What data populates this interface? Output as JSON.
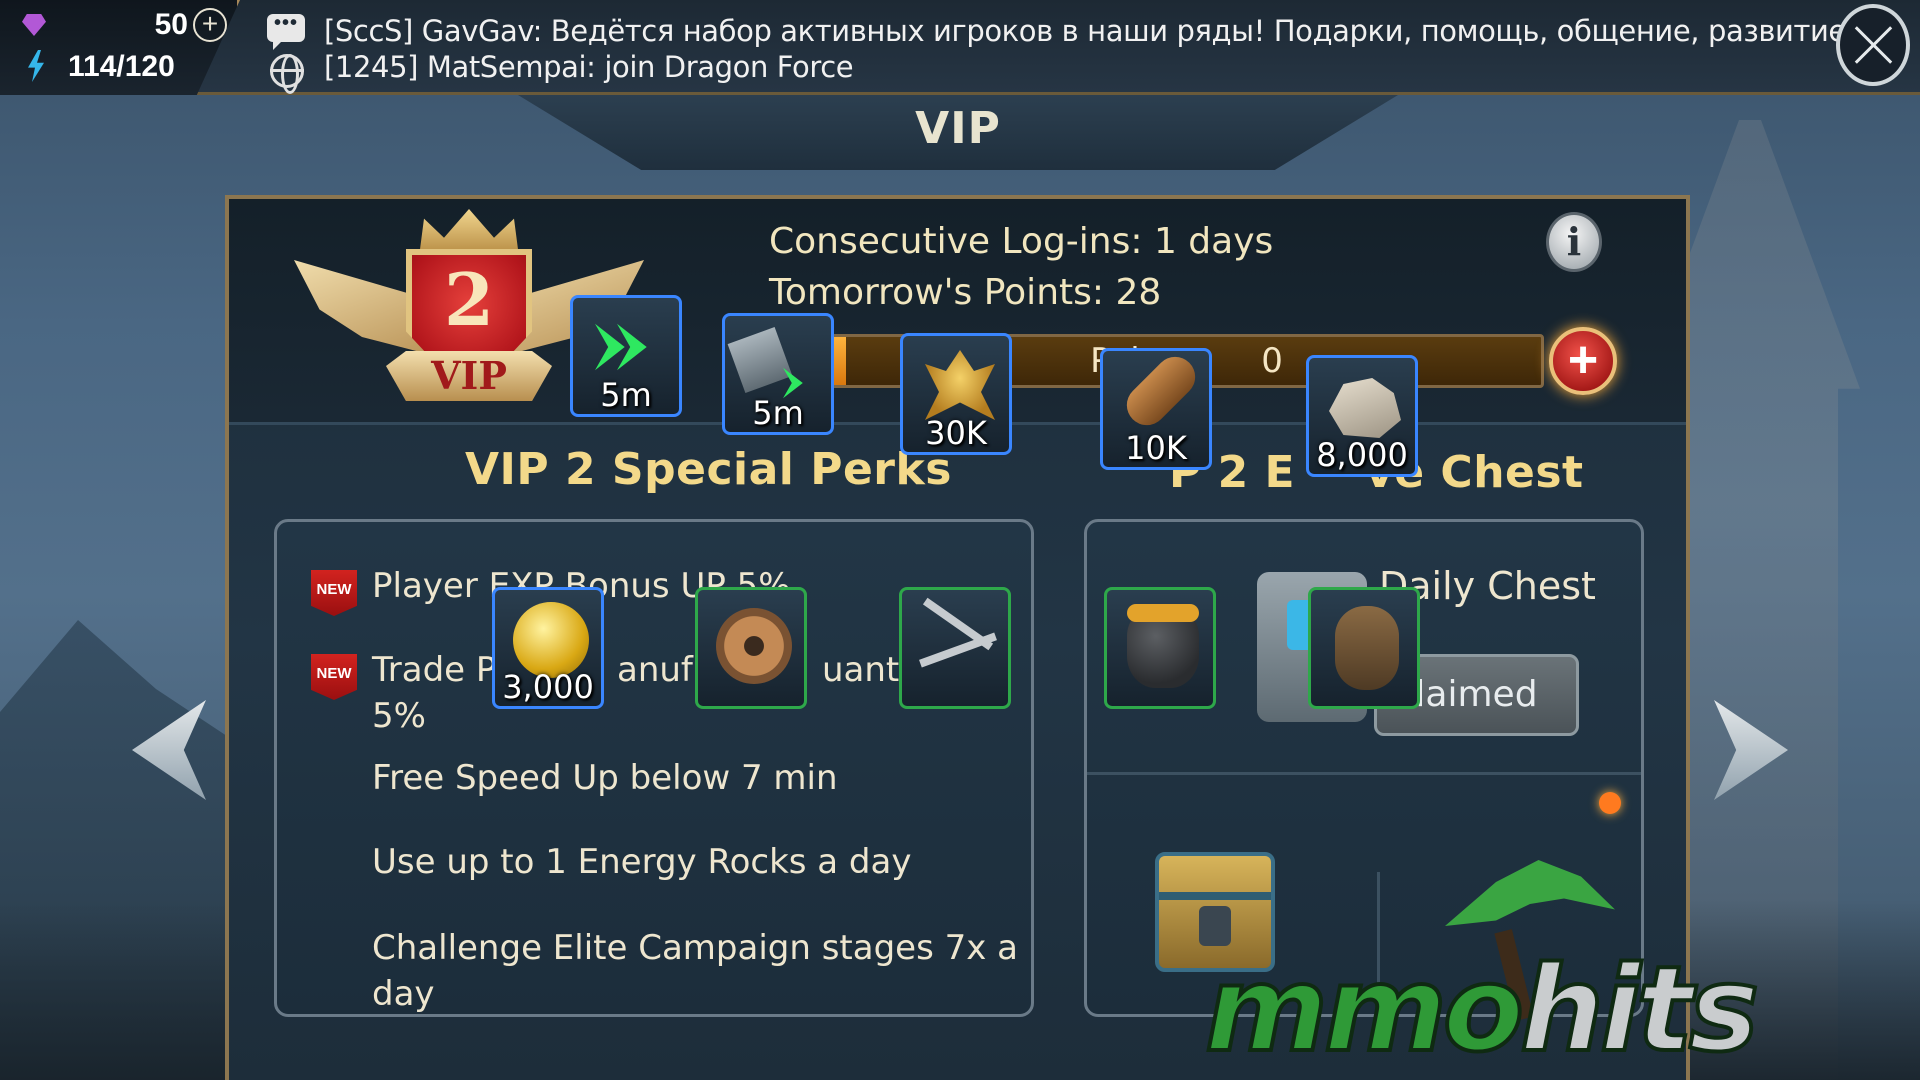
{
  "resources": {
    "gems": "50",
    "energy": "114/120"
  },
  "chat": {
    "line1": "[SccS] GavGav: Ведётся набор активных игроков в наши ряды! Подарки, помощь, общение, развитие!",
    "line2": "[1245] MatSempai: join Dragon Force"
  },
  "title": "VIP",
  "vip": {
    "level": "2",
    "badge_text": "VIP",
    "consecutive_logins": "Consecutive Log-ins: 1 days",
    "tomorrow_points": "Tomorrow's Points: 28",
    "points_label": "Poin",
    "points_label_tail": "0"
  },
  "perks": {
    "title": "VIP 2 Special Perks",
    "items": [
      {
        "text": "Player EXP Bonus UP 5%",
        "new": "NEW"
      },
      {
        "text": "Trade Pr",
        "text_mid": "anuf",
        "text_end": "uant",
        "text_line2": "5%",
        "new": "NEW"
      },
      {
        "text": "Free Speed Up below 7 min"
      },
      {
        "text": "Use up to 1 Energy Rocks a day"
      },
      {
        "text": "Challenge Elite Campaign stages 7x a",
        "text_line2": "day"
      }
    ]
  },
  "chest": {
    "title_left": "VIP 2 E",
    "title_right": "ve Chest",
    "title_fragment": "P 2 E",
    "daily_label": "Daily Chest",
    "claimed_label": "laimed"
  },
  "popup_items": [
    {
      "icon": "speedup-arrow-icon",
      "qty": "5m"
    },
    {
      "icon": "hammer-speedup-icon",
      "qty": "5m"
    },
    {
      "icon": "wheat-icon",
      "qty": "30K"
    },
    {
      "icon": "wood-log-icon",
      "qty": "10K"
    },
    {
      "icon": "stone-icon",
      "qty": "8,000"
    },
    {
      "icon": "gold-coin-icon",
      "qty": "3,000"
    },
    {
      "icon": "gear-icon",
      "qty": ""
    },
    {
      "icon": "nails-icon",
      "qty": ""
    },
    {
      "icon": "pot-icon",
      "qty": ""
    },
    {
      "icon": "pulley-icon",
      "qty": ""
    }
  ],
  "watermark": {
    "part1": "mmo",
    "part2": "hits"
  },
  "colors": {
    "accent_gold": "#f3d98a",
    "item_border_blue": "#3a86ff",
    "item_border_green": "#2ea84a",
    "new_badge_red": "#d2231f"
  }
}
